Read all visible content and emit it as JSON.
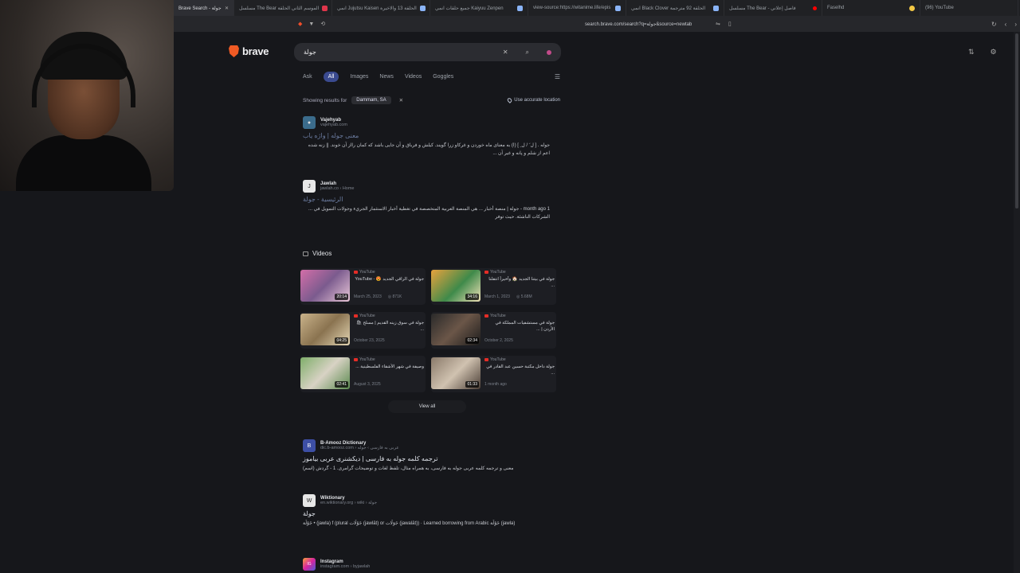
{
  "tabs": [
    {
      "title": "Brave Search - جولة",
      "active": true
    },
    {
      "title": "مسلسل The Bear الموسم الثاني الحلقة"
    },
    {
      "title": "انمي Jujutsu Kaisen الحلقة 13 والاخيرة"
    },
    {
      "title": "جميع حلقات انمي Kaiyuu Zenpen"
    },
    {
      "title": "view-source:https://witanime.life/epis"
    },
    {
      "title": "انمي Black Clover الحلقة 92 مترجمة"
    },
    {
      "title": "مسلسل The Bear - فاصل إعلاني"
    },
    {
      "title": "Faselhd"
    },
    {
      "title": "(96) YouTube"
    }
  ],
  "address": {
    "url": "search.brave.com/search?q=جولة&source=newtab"
  },
  "brand": {
    "name": "brave"
  },
  "search": {
    "query": "جولة"
  },
  "filters": [
    "Ask",
    "All",
    "Images",
    "News",
    "Videos",
    "Goggles"
  ],
  "location": {
    "label": "Showing results for",
    "value": "Dammam, SA",
    "use_accurate": "Use accurate location"
  },
  "results_top": [
    {
      "site": "Vajehyab",
      "url": "vajehyab.com",
      "fav": "V",
      "title": "معنی جوله | واژه یاب",
      "snippet": "جوله . [ ل َ / ل ِ ] (ا) به معنای ماه خوردن و غرکاو زرا گویند. کیلش و فرباق و آن جایی باشد که کمان رااز آن خوند. || زنه شده اعم از شلم و پانه و غیر آن ..."
    },
    {
      "site": "Jawlah",
      "url": "jawlah.co › Home",
      "fav": "J",
      "title": "الرئيسية - جولة",
      "snippet": "1 month ago - جولة | منصة أخبار ... هي المنصة العربية المتخصصة في تغطية أخبار الاستثمار الجريء وجولات التمويل في ... الشركات الناشئة. حيث توفر"
    }
  ],
  "videos": {
    "heading": "Videos",
    "items": [
      {
        "source": "YouTube",
        "title": "جولة في الراقي الجديد 😍 - YouTube",
        "date": "March 25, 2023",
        "views": "871K",
        "duration": "20:14"
      },
      {
        "source": "YouTube",
        "title": "جولة في بيتنا الجديد 🏠 وأخيراً انتقلنا ...",
        "date": "March 1, 2023",
        "views": "5.68M",
        "duration": "34:16"
      },
      {
        "source": "YouTube",
        "title": "جولة في سوق زينه القديم | مسلح 🛍 ...",
        "date": "October 23, 2025",
        "views": "",
        "duration": "04:25"
      },
      {
        "source": "YouTube",
        "title": "جولة في مستشفيات المملكة في الأردن | ...",
        "date": "October 2, 2025",
        "views": "",
        "duration": "02:34"
      },
      {
        "source": "YouTube",
        "title": "وصيفة في شهر الأشقاء الفلسطينية ...",
        "date": "August 3, 2025",
        "views": "",
        "duration": "02:41"
      },
      {
        "source": "YouTube",
        "title": "جولة داخل مكتبة حسين عبد القادر في ...",
        "date": "1 month ago",
        "views": "",
        "duration": "01:33"
      }
    ],
    "view_all": "View all"
  },
  "results_bottom": [
    {
      "site": "B-Amooz Dictionary",
      "url": "dic.b-amooz.com › عربی به فارسی › جوله",
      "fav": "B",
      "title": "ترجمه کلمه جوله به فارسی | دیکشنری عربی بیاموز",
      "snippet": "معنی و ترجمه کلمه عربی جوله به فارسی، به همراه مثال، تلفظ لغات و توضیحات گرامری. 1 - گردش (اسم)"
    },
    {
      "site": "Wiktionary",
      "url": "en.wiktionary.org › wiki › جولة",
      "fav": "W",
      "title": "جولة",
      "snippet": "جَوْلَة • (jawla) f (plural جَوْلَات (jawlāt) or جَوَلَات (jawalāt)) · Learned borrowing from Arabic جَوْلَة (jawla)"
    },
    {
      "site": "Instagram",
      "url": "instagram.com › byjawlah",
      "fav": "IG",
      "title": "",
      "snippet": ""
    }
  ],
  "colors": {
    "accent": "#3a4a8f",
    "brand": "#f05a24",
    "bg": "#16171b"
  }
}
